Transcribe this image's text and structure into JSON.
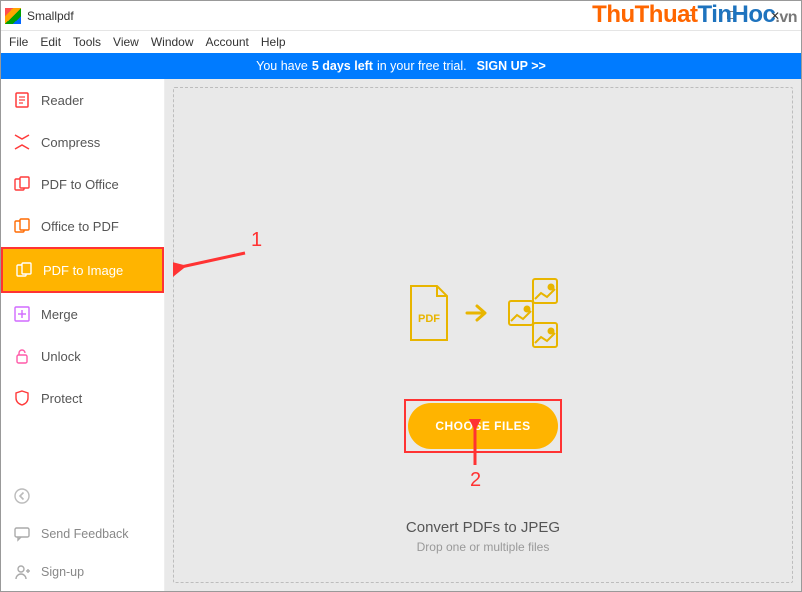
{
  "window": {
    "title": "Smallpdf"
  },
  "menubar": [
    "File",
    "Edit",
    "Tools",
    "View",
    "Window",
    "Account",
    "Help"
  ],
  "trial": {
    "prefix": "You have",
    "days": "5 days left",
    "suffix": "in your free trial.",
    "cta": "SIGN UP >>"
  },
  "sidebar": {
    "items": [
      {
        "label": "Reader"
      },
      {
        "label": "Compress"
      },
      {
        "label": "PDF to Office"
      },
      {
        "label": "Office to PDF"
      },
      {
        "label": "PDF to Image"
      },
      {
        "label": "Merge"
      },
      {
        "label": "Unlock"
      },
      {
        "label": "Protect"
      }
    ],
    "footer": {
      "back": "",
      "feedback": "Send Feedback",
      "signup": "Sign-up"
    }
  },
  "main": {
    "hero_pdf_label": "PDF",
    "choose_label": "CHOOSE FILES",
    "title": "Convert PDFs to JPEG",
    "subtitle": "Drop one or multiple files"
  },
  "annotations": {
    "n1": "1",
    "n2": "2"
  },
  "watermark": {
    "a": "ThuThuat",
    "b": "TinHoc",
    "c": ".vn"
  }
}
